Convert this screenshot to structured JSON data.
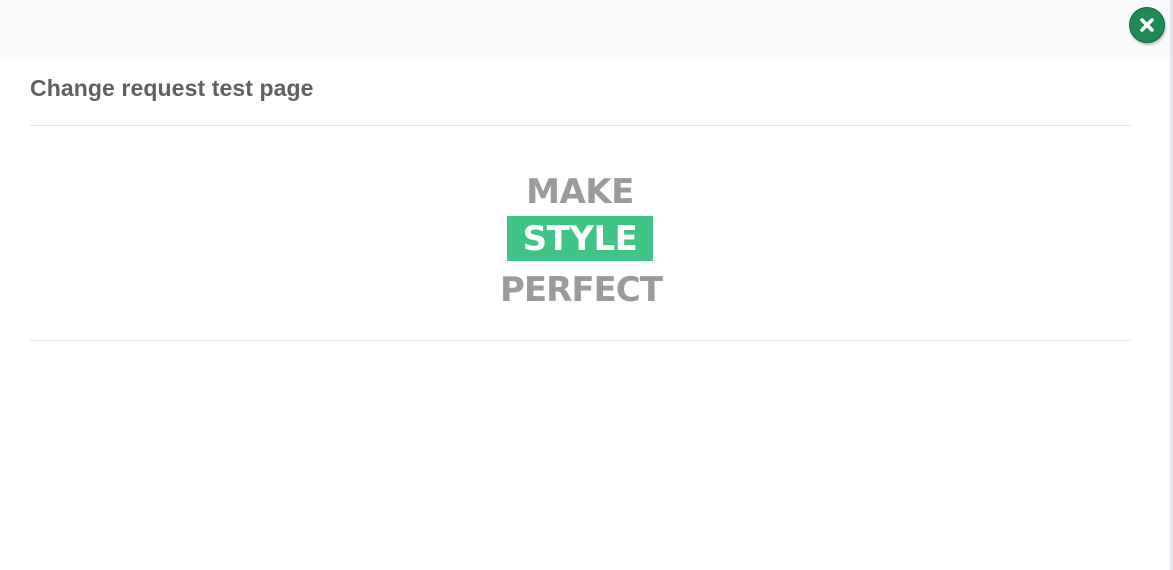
{
  "header": {
    "close_icon": "close-icon",
    "accent_color": "#1e8a55"
  },
  "main": {
    "title": "Change request test page",
    "logo": {
      "line1": "MAKE",
      "line2": "STYLE",
      "line3": "PERFECT",
      "highlight_color": "#3fc486",
      "text_color": "#9b9b9b"
    }
  }
}
